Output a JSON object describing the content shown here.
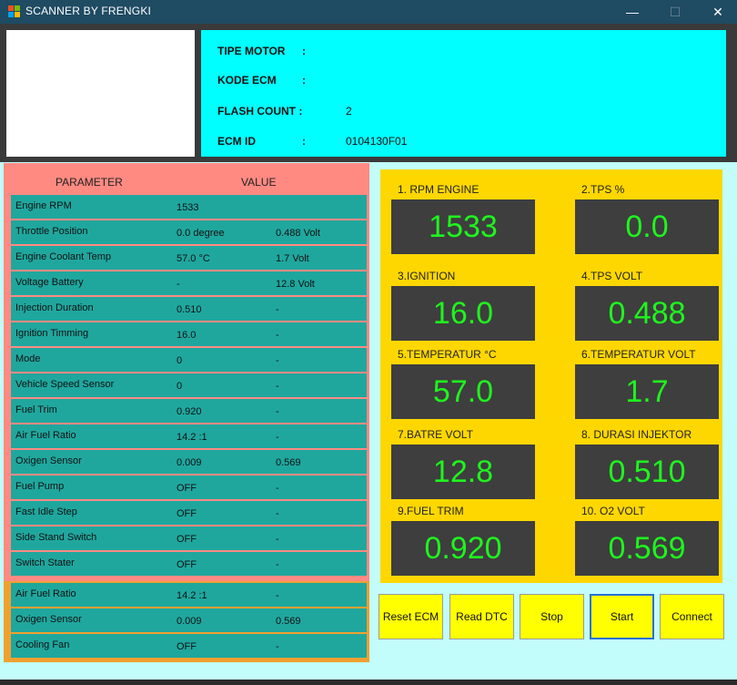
{
  "window": {
    "title": "SCANNER BY FRENGKI",
    "minimize": "—",
    "maximize": "☐",
    "close": "✕"
  },
  "header": {
    "rows": [
      {
        "label": "TIPE MOTOR",
        "colon": ":",
        "value": ""
      },
      {
        "label": "KODE ECM",
        "colon": ":",
        "value": ""
      },
      {
        "label": "FLASH COUNT :",
        "colon": "",
        "value": "2"
      },
      {
        "label": "ECM ID",
        "colon": ":",
        "value": "0104130F01"
      }
    ]
  },
  "params": {
    "col_parameter": "PARAMETER",
    "col_value": "VALUE",
    "rows": [
      {
        "name": "Engine RPM",
        "value": "1533",
        "extra": ""
      },
      {
        "name": "Throttle Position",
        "value": "0.0 degree",
        "extra": "0.488 Volt"
      },
      {
        "name": "Engine Coolant Temp",
        "value": "57.0 °C",
        "extra": "1.7 Volt"
      },
      {
        "name": "Voltage Battery",
        "value": "-",
        "extra": "12.8 Volt"
      },
      {
        "name": "Injection Duration",
        "value": "0.510",
        "extra": "-"
      },
      {
        "name": "Ignition Timming",
        "value": "16.0",
        "extra": "-"
      },
      {
        "name": "Mode",
        "value": "0",
        "extra": "-"
      },
      {
        "name": "Vehicle Speed Sensor",
        "value": "0",
        "extra": "-"
      },
      {
        "name": "Fuel Trim",
        "value": "0.920",
        "extra": "-"
      },
      {
        "name": "Air Fuel Ratio",
        "value": "14.2 :1",
        "extra": "-"
      },
      {
        "name": "Oxigen Sensor",
        "value": "0.009",
        "extra": "0.569"
      },
      {
        "name": "Fuel Pump",
        "value": "OFF",
        "extra": "-"
      },
      {
        "name": "Fast Idle Step",
        "value": "OFF",
        "extra": "-"
      },
      {
        "name": "Side Stand Switch",
        "value": "OFF",
        "extra": "-"
      },
      {
        "name": "Switch Stater",
        "value": "OFF",
        "extra": "-"
      }
    ],
    "extra_rows": [
      {
        "name": "Air Fuel Ratio",
        "value": "14.2 :1",
        "extra": "-"
      },
      {
        "name": "Oxigen Sensor",
        "value": "0.009",
        "extra": "0.569"
      },
      {
        "name": "Cooling Fan",
        "value": "OFF",
        "extra": "-"
      }
    ]
  },
  "gauges": [
    {
      "label": "1. RPM ENGINE",
      "value": "1533"
    },
    {
      "label": "2.TPS %",
      "value": "0.0"
    },
    {
      "label": "3.IGNITION",
      "value": "16.0"
    },
    {
      "label": "4.TPS  VOLT",
      "value": "0.488"
    },
    {
      "label": "5.TEMPERATUR °C",
      "value": "57.0"
    },
    {
      "label": "6.TEMPERATUR VOLT",
      "value": "1.7"
    },
    {
      "label": "7.BATRE  VOLT",
      "value": "12.8"
    },
    {
      "label": "8. DURASI INJEKTOR",
      "value": "0.510"
    },
    {
      "label": "9.FUEL TRIM",
      "value": "0.920"
    },
    {
      "label": "10. O2 VOLT",
      "value": "0.569"
    }
  ],
  "buttons": {
    "reset": "Reset ECM",
    "read_dtc": "Read DTC",
    "stop": "Stop",
    "start": "Start",
    "connect": "Connect"
  },
  "colors": {
    "gauge_text": "#1ef51e",
    "info_bg": "#00ffff",
    "param_bg": "#ff8a82",
    "row_bg": "#1fa79e",
    "gauge_panel": "#ffd700",
    "button_bg": "#ffff00"
  }
}
